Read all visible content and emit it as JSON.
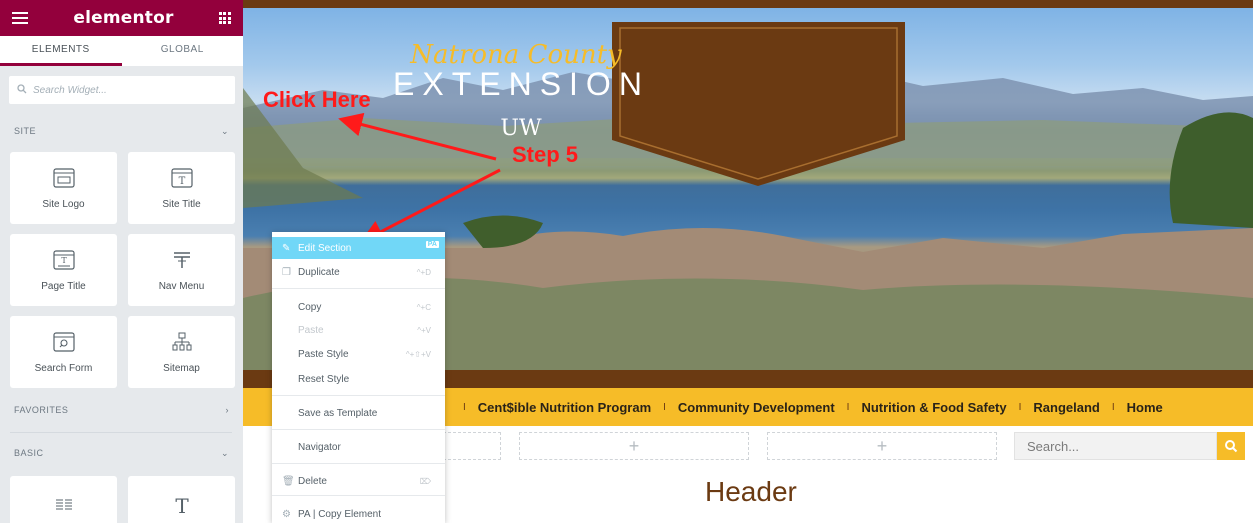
{
  "sidebar": {
    "brand": "elementor",
    "tabs": [
      "ELEMENTS",
      "GLOBAL"
    ],
    "search_placeholder": "Search Widget...",
    "site_label": "SITE",
    "favorites_label": "FAVORITES",
    "basic_label": "BASIC",
    "widgets": [
      "Site Logo",
      "Site Title",
      "Page Title",
      "Nav Menu",
      "Search Form",
      "Sitemap"
    ]
  },
  "banner": {
    "line1": "Natrona County",
    "line2": "EXTENSION",
    "line3": "UW"
  },
  "annotations": {
    "click_here": "Click Here",
    "step": "Step 5"
  },
  "nav": {
    "items": [
      "Cent$ible Nutrition Program",
      "Community Development",
      "Nutrition & Food Safety",
      "Rangeland",
      "Home"
    ],
    "separator": "I"
  },
  "search": {
    "placeholder": "Search..."
  },
  "placeholders": {
    "plus": "+"
  },
  "page": {
    "heading": "Header"
  },
  "context_menu": {
    "items": [
      {
        "label": "Edit Section",
        "shortcut": "",
        "badge": "PA"
      },
      {
        "label": "Duplicate",
        "shortcut": "^+D"
      },
      {
        "label": "Copy",
        "shortcut": "^+C"
      },
      {
        "label": "Paste",
        "shortcut": "^+V"
      },
      {
        "label": "Paste Style",
        "shortcut": "^+⇧+V"
      },
      {
        "label": "Reset Style",
        "shortcut": ""
      },
      {
        "label": "Save as Template",
        "shortcut": ""
      },
      {
        "label": "Navigator",
        "shortcut": ""
      },
      {
        "label": "Delete",
        "shortcut": "⌦"
      },
      {
        "label": "PA | Copy Element",
        "shortcut": ""
      }
    ]
  },
  "colors": {
    "brand": "#93003c",
    "nav_bar": "#f6bc28",
    "banner_brown": "#6b3a12",
    "highlight": "#71d7f7",
    "annotation": "#ff1a1a"
  }
}
